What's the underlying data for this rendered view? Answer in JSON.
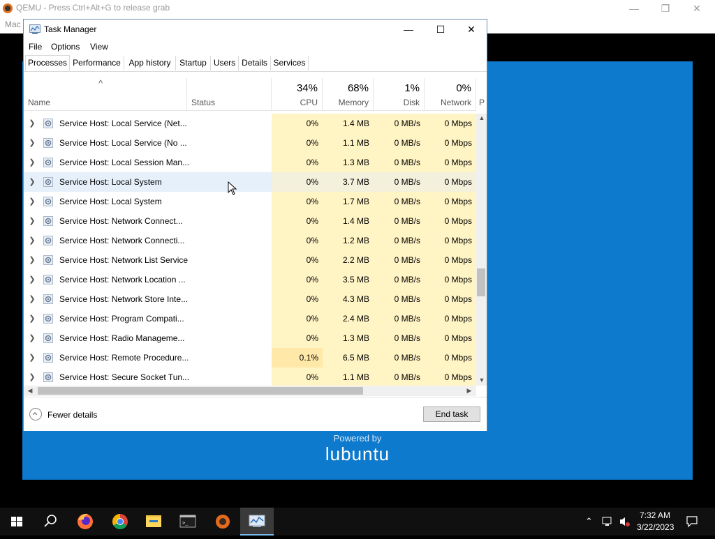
{
  "qemu": {
    "title": "QEMU - Press Ctrl+Alt+G to release grab",
    "menu_label": "Mac",
    "minimize": "—",
    "restore": "❐",
    "close": "✕"
  },
  "guest": {
    "powered_by": "Powered by",
    "logo_text": "lubuntu",
    "brand_color": "#0e7acd"
  },
  "task_manager": {
    "title": "Task Manager",
    "controls": {
      "minimize": "—",
      "maximize": "☐",
      "close": "✕"
    },
    "menu": [
      "File",
      "Options",
      "View"
    ],
    "tabs": [
      "Processes",
      "Performance",
      "App history",
      "Startup",
      "Users",
      "Details",
      "Services"
    ],
    "active_tab": "Processes",
    "header": {
      "sort_arrow": "^",
      "name": "Name",
      "status": "Status",
      "cpu": {
        "pct": "34%",
        "label": "CPU"
      },
      "memory": {
        "pct": "68%",
        "label": "Memory"
      },
      "disk": {
        "pct": "1%",
        "label": "Disk"
      },
      "network": {
        "pct": "0%",
        "label": "Network"
      },
      "power": "P"
    },
    "rows": [
      {
        "name": "Service Host: Local Service (Net...",
        "cpu": "0%",
        "memory": "1.4 MB",
        "disk": "0 MB/s",
        "network": "0 Mbps"
      },
      {
        "name": "Service Host: Local Service (No ...",
        "cpu": "0%",
        "memory": "1.1 MB",
        "disk": "0 MB/s",
        "network": "0 Mbps"
      },
      {
        "name": "Service Host: Local Session Man...",
        "cpu": "0%",
        "memory": "1.3 MB",
        "disk": "0 MB/s",
        "network": "0 Mbps"
      },
      {
        "name": "Service Host: Local System",
        "cpu": "0%",
        "memory": "3.7 MB",
        "disk": "0 MB/s",
        "network": "0 Mbps"
      },
      {
        "name": "Service Host: Local System",
        "cpu": "0%",
        "memory": "1.7 MB",
        "disk": "0 MB/s",
        "network": "0 Mbps"
      },
      {
        "name": "Service Host: Network Connect...",
        "cpu": "0%",
        "memory": "1.4 MB",
        "disk": "0 MB/s",
        "network": "0 Mbps"
      },
      {
        "name": "Service Host: Network Connecti...",
        "cpu": "0%",
        "memory": "1.2 MB",
        "disk": "0 MB/s",
        "network": "0 Mbps"
      },
      {
        "name": "Service Host: Network List Service",
        "cpu": "0%",
        "memory": "2.2 MB",
        "disk": "0 MB/s",
        "network": "0 Mbps"
      },
      {
        "name": "Service Host: Network Location ...",
        "cpu": "0%",
        "memory": "3.5 MB",
        "disk": "0 MB/s",
        "network": "0 Mbps"
      },
      {
        "name": "Service Host: Network Store Inte...",
        "cpu": "0%",
        "memory": "4.3 MB",
        "disk": "0 MB/s",
        "network": "0 Mbps"
      },
      {
        "name": "Service Host: Program Compati...",
        "cpu": "0%",
        "memory": "2.4 MB",
        "disk": "0 MB/s",
        "network": "0 Mbps"
      },
      {
        "name": "Service Host: Radio Manageme...",
        "cpu": "0%",
        "memory": "1.3 MB",
        "disk": "0 MB/s",
        "network": "0 Mbps"
      },
      {
        "name": "Service Host: Remote Procedure...",
        "cpu": "0.1%",
        "memory": "6.5 MB",
        "disk": "0 MB/s",
        "network": "0 Mbps"
      },
      {
        "name": "Service Host: Secure Socket Tun...",
        "cpu": "0%",
        "memory": "1.1 MB",
        "disk": "0 MB/s",
        "network": "0 Mbps"
      }
    ],
    "fewer_details": "Fewer details",
    "end_task": "End task"
  },
  "taskbar": {
    "icons": [
      "windows-start-icon",
      "search-icon",
      "firefox-icon",
      "chrome-icon",
      "file-explorer-icon",
      "terminal-icon",
      "qemu-app-icon",
      "task-manager-icon"
    ],
    "time": "7:32 AM",
    "date": "3/22/2023"
  }
}
